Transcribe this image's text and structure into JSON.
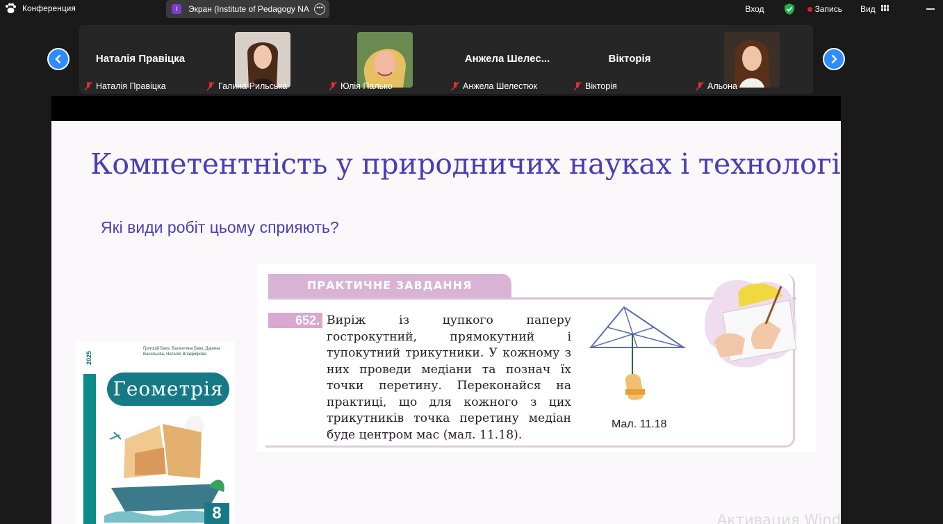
{
  "topbar": {
    "app_title": "Конференция",
    "screen_badge": "I",
    "screen_label": "Экран (Institute of Pedagogy NA",
    "login": "Вход",
    "record": "Запись",
    "view": "Вид"
  },
  "participants": [
    {
      "display_name": "Наталія Правіцка",
      "label": "Наталія Правіцка",
      "has_video": false
    },
    {
      "display_name": "",
      "label": "Галина Рильська",
      "has_video": true
    },
    {
      "display_name": "",
      "label": "Юлія Палько",
      "has_video": true
    },
    {
      "display_name": "Анжела  Шелес...",
      "label": "Анжела Шелестюк",
      "has_video": false
    },
    {
      "display_name": "Вікторія",
      "label": "Вікторія",
      "has_video": false
    },
    {
      "display_name": "",
      "label": "Альона",
      "has_video": true
    }
  ],
  "slide": {
    "title": "Компетентність у природничих науках і технологіях",
    "question": "Які види робіт цьому сприяють?",
    "task": {
      "header": "ПРАКТИЧНЕ ЗАВДАННЯ",
      "number": "652.",
      "text": "Виріж із цупкого паперу гострокутний, прямокутний і тупокутний трикутники. У кожному з них проведи медіани та познач їх точки перетину. Переконайся на практиці, що для кожного з цих трикутників точка перетину медіан буде центром мас (мал. 11.18).",
      "figure_caption": "Мал. 11.18"
    },
    "book": {
      "year": "2025",
      "authors": "Григорій Бевз, Валентина Бевз, Дарина Васильєва, Наталія Владімірова",
      "title": "Геометрія",
      "spine": "ГЕОМЕТРІЯ",
      "grade": "8"
    },
    "watermark": "Активация Wind"
  },
  "colors": {
    "accent_blue": "#2d8cff",
    "slide_title": "#4b3eb4",
    "task_pink": "#d9b3d4",
    "book_teal": "#157a86"
  }
}
